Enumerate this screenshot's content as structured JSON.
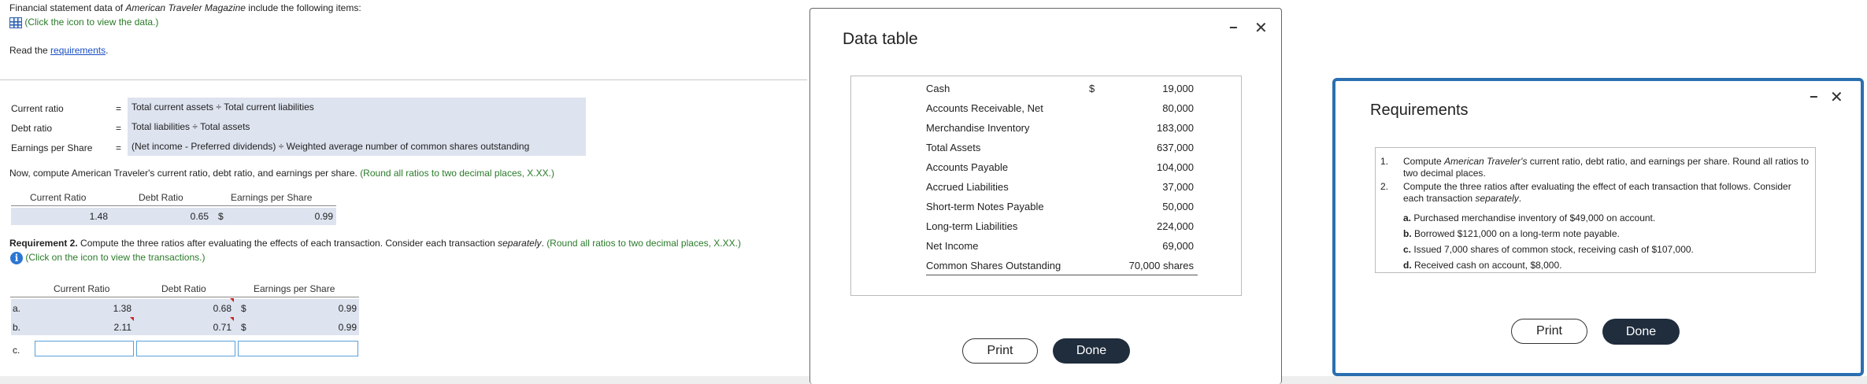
{
  "intro": {
    "line_pre": "Financial statement data of ",
    "company_italic": "American Traveler Magazine",
    "line_post": " include the following items:",
    "data_link": "(Click the icon to view the data.)",
    "read_pre": "Read the ",
    "requirements_link": "requirements",
    "read_post": "."
  },
  "formulas": [
    {
      "name": "Current ratio",
      "eq": "=",
      "formula": "Total current assets ÷ Total current liabilities"
    },
    {
      "name": "Debt ratio",
      "eq": "=",
      "formula": "Total liabilities ÷ Total assets"
    },
    {
      "name": "Earnings per Share",
      "eq": "=",
      "formula": "(Net income - Preferred dividends) ÷ Weighted average number of common shares outstanding"
    }
  ],
  "req1": {
    "text": "Now, compute American Traveler's current ratio, debt ratio, and earnings per share.",
    "hint": "(Round all ratios to two decimal places, X.XX.)",
    "headers": {
      "current": "Current Ratio",
      "debt": "Debt Ratio",
      "eps": "Earnings per Share"
    },
    "values": {
      "current": "1.48",
      "debt": "0.65",
      "dollar": "$",
      "eps": "0.99"
    }
  },
  "req2": {
    "label": "Requirement 2.",
    "text_pre": " Compute the three ratios after evaluating the effects of each transaction. Consider each transaction ",
    "text_italic": "separately",
    "text_post": ".",
    "hint": "(Round all ratios to two decimal places, X.XX.)",
    "trans_link": "(Click on the icon to view the transactions.)",
    "headers": {
      "current": "Current Ratio",
      "debt": "Debt Ratio",
      "eps": "Earnings per Share"
    },
    "rows": [
      {
        "label": "a.",
        "current": "1.38",
        "debt": "0.68",
        "dollar": "$",
        "eps": "0.99"
      },
      {
        "label": "b.",
        "current": "2.11",
        "debt": "0.71",
        "dollar": "$",
        "eps": "0.99"
      },
      {
        "label": "c.",
        "current": "",
        "debt": "",
        "dollar": "",
        "eps": ""
      }
    ]
  },
  "data_table": {
    "title": "Data table",
    "rows": [
      {
        "label": "Cash",
        "dollar": "$",
        "value": "19,000"
      },
      {
        "label": "Accounts Receivable, Net",
        "dollar": "",
        "value": "80,000"
      },
      {
        "label": "Merchandise Inventory",
        "dollar": "",
        "value": "183,000"
      },
      {
        "label": "Total Assets",
        "dollar": "",
        "value": "637,000"
      },
      {
        "label": "Accounts Payable",
        "dollar": "",
        "value": "104,000"
      },
      {
        "label": "Accrued Liabilities",
        "dollar": "",
        "value": "37,000"
      },
      {
        "label": "Short-term Notes Payable",
        "dollar": "",
        "value": "50,000"
      },
      {
        "label": "Long-term Liabilities",
        "dollar": "",
        "value": "224,000"
      },
      {
        "label": "Net Income",
        "dollar": "",
        "value": "69,000"
      },
      {
        "label": "Common Shares Outstanding",
        "dollar": "",
        "value": "70,000 shares"
      }
    ],
    "print_label": "Print",
    "done_label": "Done"
  },
  "requirements_panel": {
    "title": "Requirements",
    "item1_num": "1.",
    "item1_pre": "Compute ",
    "item1_italic": "American Traveler's",
    "item1_post": " current ratio, debt ratio, and earnings per share. Round all ratios to two decimal places.",
    "item2_num": "2.",
    "item2_text": "Compute the three ratios after evaluating the effect of each transaction that follows. Consider each transaction ",
    "item2_italic": "separately",
    "item2_post": ".",
    "sub": [
      {
        "letter": "a.",
        "text": "Purchased merchandise inventory of $49,000 on account."
      },
      {
        "letter": "b.",
        "text": "Borrowed $121,000 on a long-term note payable."
      },
      {
        "letter": "c.",
        "text": "Issued 7,000 shares of common stock, receiving cash of $107,000."
      },
      {
        "letter": "d.",
        "text": "Received cash on account, $8,000."
      }
    ],
    "print_label": "Print",
    "done_label": "Done"
  },
  "colors": {
    "accent_link": "#1a4fc4",
    "hint_green": "#2a7a2a",
    "button_dark": "#1f2d3d",
    "highlight": "#dde3ef",
    "panel_border": "#2a6fb0"
  }
}
